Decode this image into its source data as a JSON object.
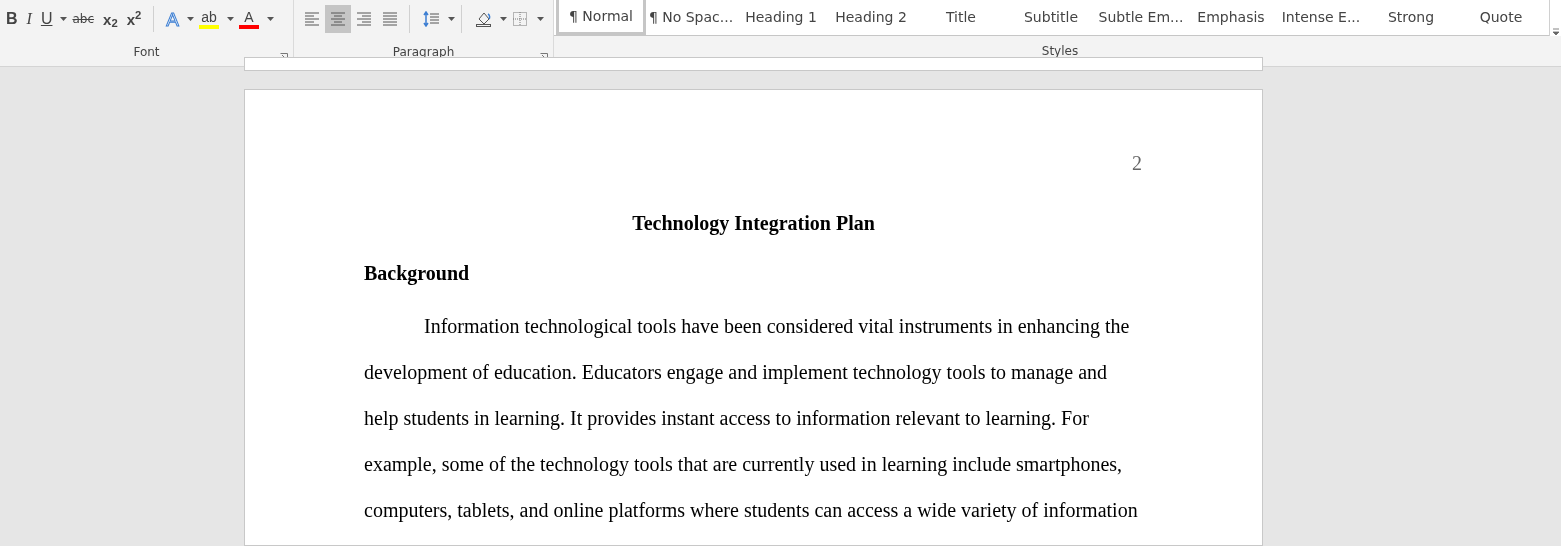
{
  "ribbon": {
    "font_group": {
      "label": "Font",
      "buttons": [
        {
          "kind": "bold",
          "label": "B",
          "dropdown": false
        },
        {
          "kind": "italic",
          "label": "I",
          "dropdown": false
        },
        {
          "kind": "underline",
          "label": "U",
          "dropdown": true
        },
        {
          "kind": "strike",
          "label": "abc",
          "dropdown": false
        },
        {
          "kind": "script",
          "label": "x$_{2}$",
          "dropdown": false
        },
        {
          "kind": "script",
          "label": "x$^{2}$",
          "dropdown": false
        },
        {
          "kind": "effects",
          "label": "A",
          "dropdown": true
        },
        {
          "kind": "color",
          "label": "ab",
          "color": "#ffff00",
          "dropdown": true
        },
        {
          "kind": "color",
          "label": "A",
          "color": "#ff0000",
          "dropdown": true
        }
      ]
    },
    "paragraph_group": {
      "label": "Paragraph",
      "buttons": [
        {
          "kind": "align-left",
          "selected": false
        },
        {
          "kind": "align-center",
          "selected": true
        },
        {
          "kind": "align-right",
          "selected": false
        },
        {
          "kind": "justify",
          "selected": false
        },
        {
          "kind": "line-spacing"
        },
        {
          "kind": "shading"
        },
        {
          "kind": "borders"
        }
      ]
    },
    "styles_group": {
      "label": "Styles",
      "items": [
        {
          "label": "¶ Normal",
          "selected": true
        },
        {
          "label": "¶ No Spac...",
          "selected": false
        },
        {
          "label": "Heading 1",
          "selected": false
        },
        {
          "label": "Heading 2",
          "selected": false
        },
        {
          "label": "Title",
          "selected": false
        },
        {
          "label": "Subtitle",
          "selected": false
        },
        {
          "label": "Subtle Em...",
          "selected": false
        },
        {
          "label": "Emphasis",
          "selected": false
        },
        {
          "label": "Intense E...",
          "selected": false
        },
        {
          "label": "Strong",
          "selected": false
        },
        {
          "label": "Quote",
          "selected": false
        }
      ]
    }
  },
  "document": {
    "page_number": "2",
    "title": "Technology Integration Plan",
    "heading": "Background",
    "paragraph": "Information technological tools have been considered vital instruments in enhancing the development of education. Educators engage and implement technology tools to manage and help students in learning. It provides instant access to information relevant to learning. For example, some of the technology tools that are currently used in learning include smartphones, computers, tablets, and online platforms where students can access a wide variety of information"
  }
}
